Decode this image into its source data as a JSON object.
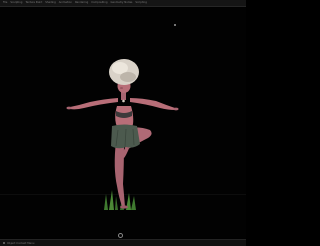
{
  "menubar": {
    "items": [
      {
        "label": "File"
      },
      {
        "label": "Sculpting"
      },
      {
        "label": "Texture Paint"
      },
      {
        "label": "Shading"
      },
      {
        "label": "Animation"
      },
      {
        "label": "Rendering"
      },
      {
        "label": "Compositing"
      },
      {
        "label": "Geometry Nodes"
      },
      {
        "label": "Scripting"
      }
    ]
  },
  "viewport": {
    "subject": "stylized-dancer-figure",
    "background_color": "#020202",
    "skin_color": "#b86e78",
    "hair_color": "#d9d2c8",
    "skirt_color": "#4c5a4e",
    "grass_color": "#3f7a2f"
  },
  "statusbar": {
    "text": "Object Context Menu"
  }
}
